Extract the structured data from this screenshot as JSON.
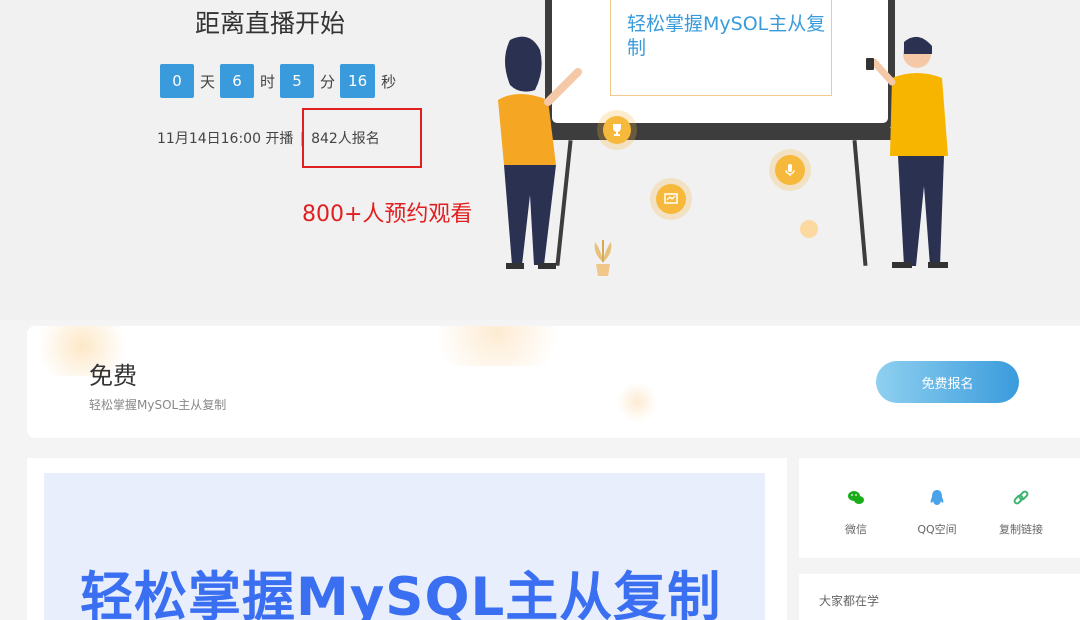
{
  "countdown": {
    "title": "距离直播开始",
    "items": [
      {
        "value": "0",
        "unit": "天"
      },
      {
        "value": "6",
        "unit": "时"
      },
      {
        "value": "5",
        "unit": "分"
      },
      {
        "value": "16",
        "unit": "秒"
      }
    ],
    "start_time": "11月14日16:00 开播",
    "separator": "|",
    "signups": "842人报名"
  },
  "annotation": "800+人预约观看",
  "illustration": {
    "board_title": "轻松掌握MySOL主从复制",
    "icons": [
      "trophy-icon",
      "chart-icon",
      "microphone-icon"
    ]
  },
  "free_card": {
    "title": "免费",
    "subtitle": "轻松掌握MySOL主从复制",
    "button_label": "免费报名"
  },
  "banner": {
    "title": "轻松掌握MySQL主从复制"
  },
  "share": {
    "items": [
      {
        "icon": "wechat-icon",
        "label": "微信"
      },
      {
        "icon": "qq-icon",
        "label": "QQ空间"
      },
      {
        "icon": "link-icon",
        "label": "复制链接"
      }
    ]
  },
  "learning": {
    "title": "大家都在学"
  },
  "colors": {
    "accent": "#3a9bdc",
    "annotation": "#e02020",
    "banner_text": "#3a6ff2"
  }
}
